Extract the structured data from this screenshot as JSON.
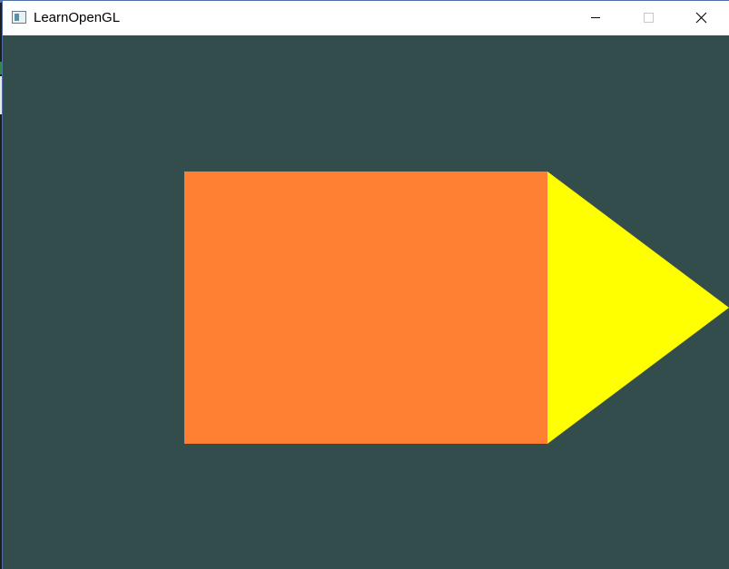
{
  "window": {
    "title": "LearnOpenGL",
    "controls": {
      "minimize_icon": "minimize-icon",
      "maximize_icon": "maximize-icon",
      "close_icon": "close-icon"
    }
  },
  "scene": {
    "clear_color": "#334d4d",
    "shapes": [
      {
        "kind": "rectangle",
        "color": "#ff7f33"
      },
      {
        "kind": "triangle",
        "color": "#ffff00"
      }
    ]
  }
}
